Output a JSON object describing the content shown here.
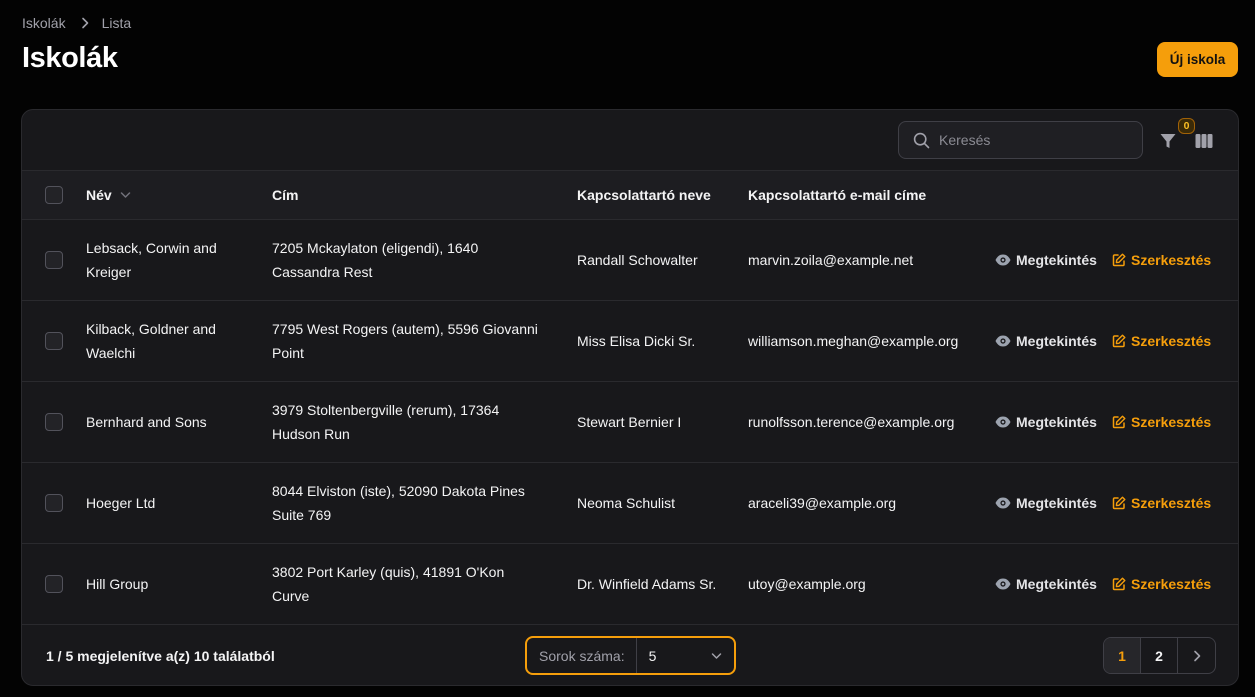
{
  "breadcrumb": {
    "root": "Iskolák",
    "current": "Lista"
  },
  "page": {
    "title": "Iskolák",
    "new_button": "Új iskola"
  },
  "toolbar": {
    "search_placeholder": "Keresés",
    "filter_count": "0"
  },
  "table": {
    "columns": {
      "name": "Név",
      "address": "Cím",
      "contact_name": "Kapcsolattartó neve",
      "contact_email": "Kapcsolattartó e-mail címe"
    },
    "rows": [
      {
        "name": [
          "Lebsack, Corwin and",
          "Kreiger"
        ],
        "address": [
          "7205 Mckaylaton (eligendi), 1640",
          "Cassandra Rest"
        ],
        "contact_name": "Randall Schowalter",
        "contact_email": "marvin.zoila@example.net"
      },
      {
        "name": [
          "Kilback, Goldner and",
          "Waelchi"
        ],
        "address": [
          "7795 West Rogers (autem), 5596 Giovanni",
          "Point"
        ],
        "contact_name": "Miss Elisa Dicki Sr.",
        "contact_email": "williamson.meghan@example.org"
      },
      {
        "name": [
          "Bernhard and Sons",
          ""
        ],
        "address": [
          "3979 Stoltenbergville (rerum), 17364",
          "Hudson Run"
        ],
        "contact_name": "Stewart Bernier I",
        "contact_email": "runolfsson.terence@example.org"
      },
      {
        "name": [
          "Hoeger Ltd",
          ""
        ],
        "address": [
          "8044 Elviston (iste), 52090 Dakota Pines",
          "Suite 769"
        ],
        "contact_name": "Neoma Schulist",
        "contact_email": "araceli39@example.org"
      },
      {
        "name": [
          "Hill Group",
          ""
        ],
        "address": [
          "3802 Port Karley (quis), 41891 O'Kon",
          "Curve"
        ],
        "contact_name": "Dr. Winfield Adams Sr.",
        "contact_email": "utoy@example.org"
      }
    ],
    "actions": {
      "view": "Megtekintés",
      "edit": "Szerkesztés"
    }
  },
  "footer": {
    "summary": "1 / 5 megjelenítve a(z) 10 találatból",
    "per_page_label": "Sorok száma:",
    "per_page_value": "5",
    "pages": [
      "1",
      "2"
    ]
  },
  "colors": {
    "accent": "#f59e0b",
    "background": "#030303",
    "panel": "#18181b"
  }
}
